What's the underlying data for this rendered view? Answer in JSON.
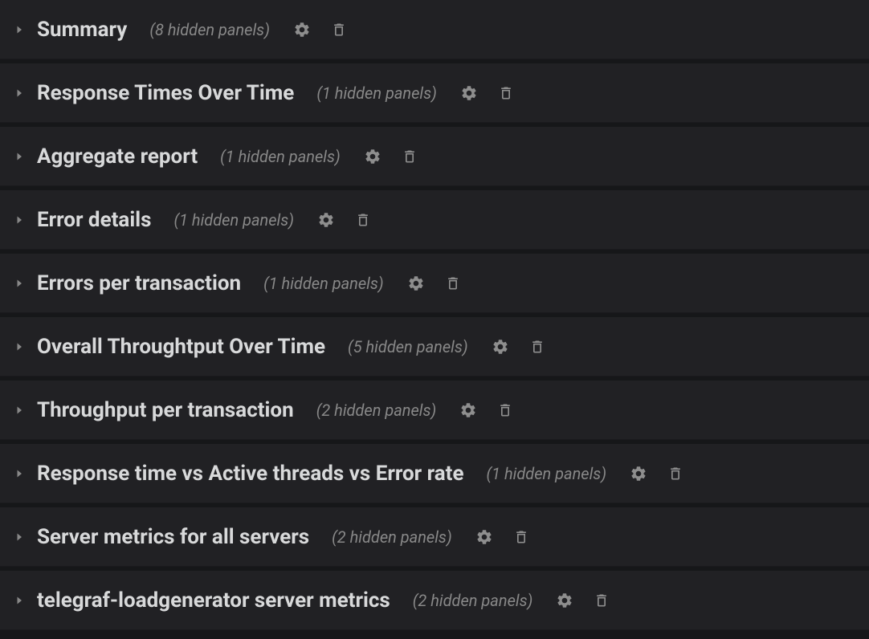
{
  "rows": [
    {
      "title": "Summary",
      "hidden": "(8 hidden panels)"
    },
    {
      "title": "Response Times Over Time",
      "hidden": "(1 hidden panels)"
    },
    {
      "title": "Aggregate report",
      "hidden": "(1 hidden panels)"
    },
    {
      "title": "Error details",
      "hidden": "(1 hidden panels)"
    },
    {
      "title": "Errors per transaction",
      "hidden": "(1 hidden panels)"
    },
    {
      "title": "Overall Throughtput Over Time",
      "hidden": "(5 hidden panels)"
    },
    {
      "title": "Throughput per transaction",
      "hidden": "(2 hidden panels)"
    },
    {
      "title": "Response time vs Active threads vs Error rate",
      "hidden": "(1 hidden panels)"
    },
    {
      "title": "Server metrics for all servers",
      "hidden": "(2 hidden panels)"
    },
    {
      "title": "telegraf-loadgenerator server metrics",
      "hidden": "(2 hidden panels)"
    }
  ]
}
